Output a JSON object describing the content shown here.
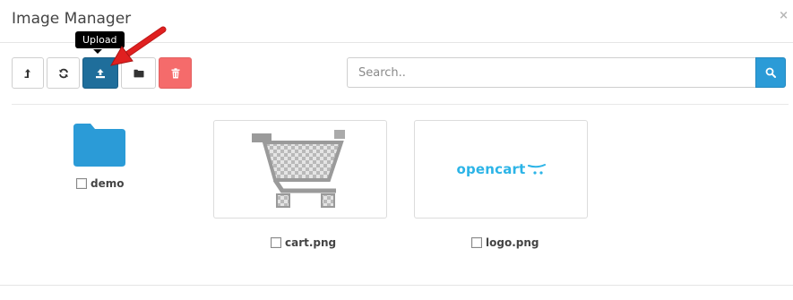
{
  "modal": {
    "title": "Image Manager",
    "close_label": "×"
  },
  "toolbar": {
    "tooltip": "Upload",
    "buttons": [
      {
        "name": "parent",
        "icon": "level-up-icon"
      },
      {
        "name": "refresh",
        "icon": "refresh-icon"
      },
      {
        "name": "upload",
        "icon": "upload-icon",
        "color": "#1f6e9b"
      },
      {
        "name": "new-folder",
        "icon": "folder-icon"
      },
      {
        "name": "delete",
        "icon": "trash-icon",
        "color": "#f56b6b"
      }
    ]
  },
  "search": {
    "placeholder": "Search..",
    "value": "",
    "button_icon": "search-icon",
    "button_color": "#2b9bd7"
  },
  "items": [
    {
      "type": "folder",
      "label": "demo",
      "icon": "folder-icon",
      "color": "#2b9bd7"
    },
    {
      "type": "image",
      "label": "cart.png",
      "preview": "cart-icon"
    },
    {
      "type": "image",
      "label": "logo.png",
      "preview": "opencart-logo",
      "logo_text": "opencart"
    }
  ]
}
